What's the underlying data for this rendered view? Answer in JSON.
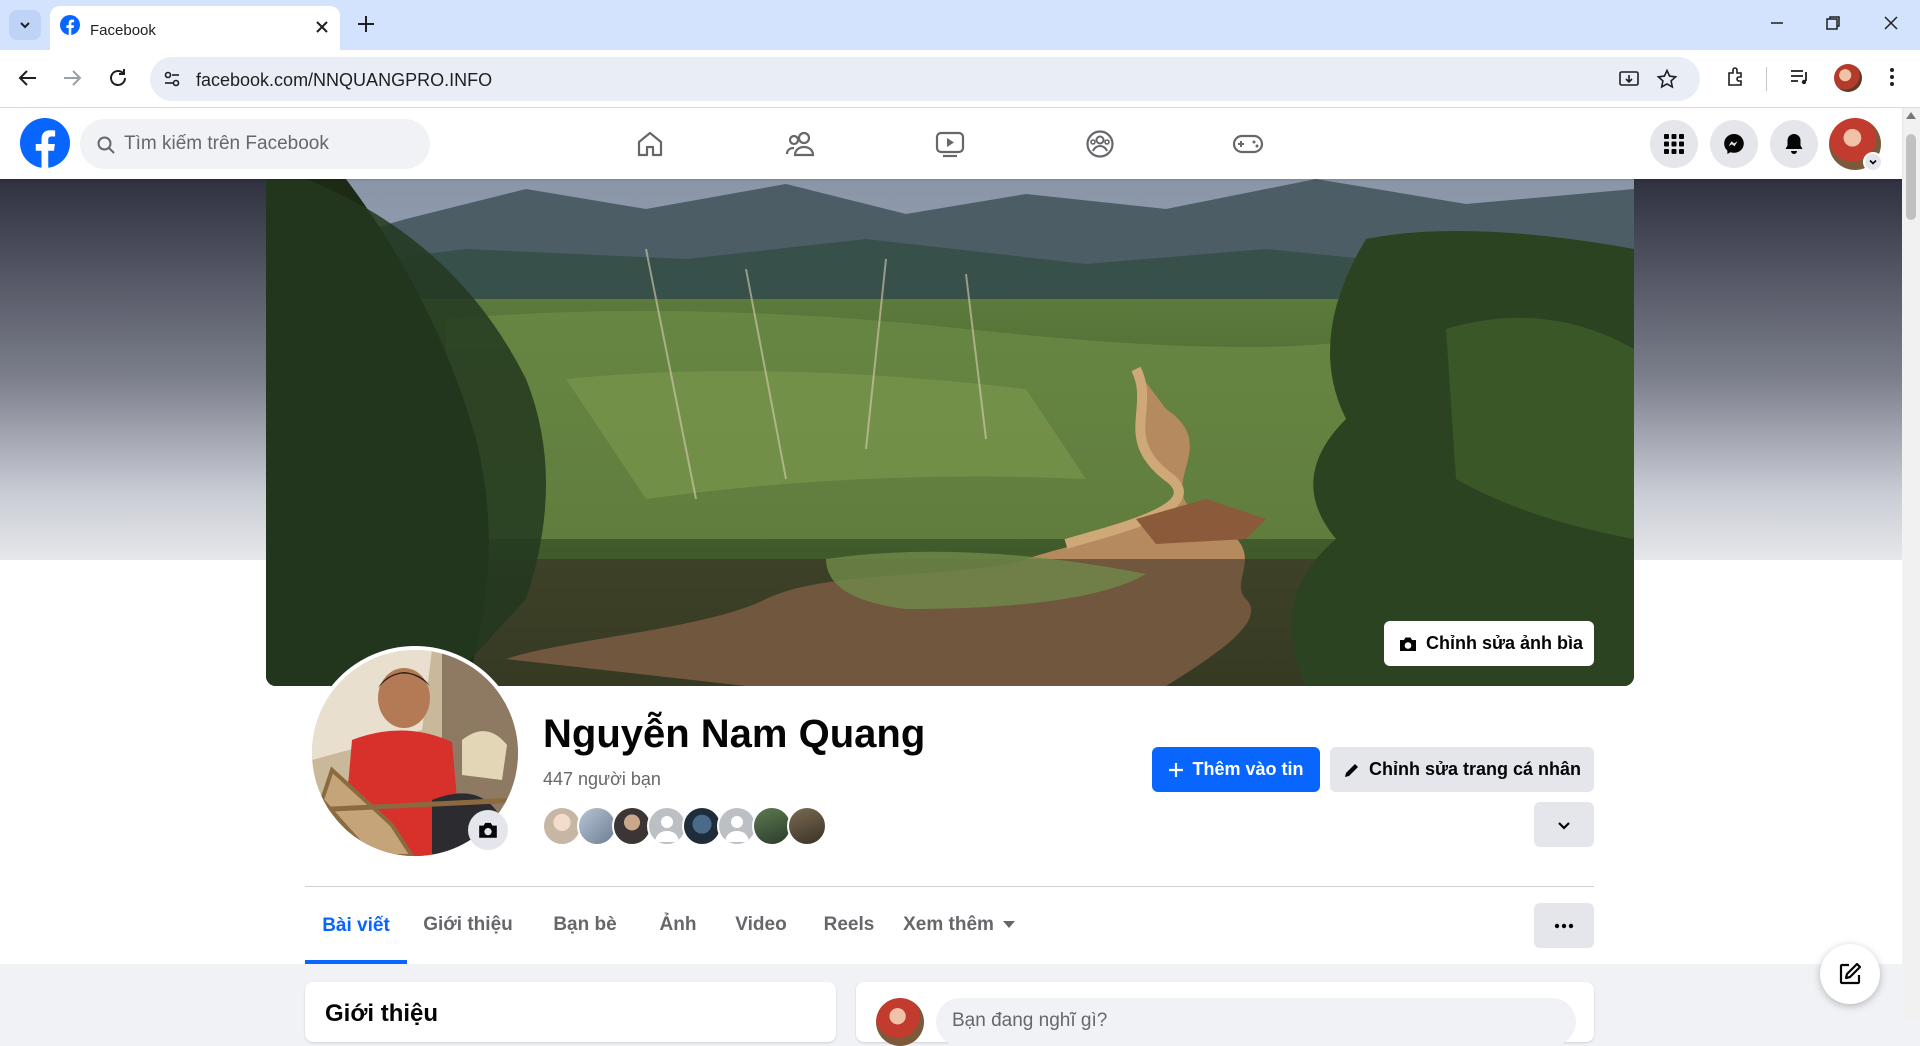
{
  "browser": {
    "tab_title": "Facebook",
    "url": "facebook.com/NNQUANGPRO.INFO"
  },
  "fb_header": {
    "search_placeholder": "Tìm kiếm trên Facebook"
  },
  "profile": {
    "name": "Nguyễn Nam Quang",
    "friend_count": "447 người bạn",
    "edit_cover_label": "Chỉnh sửa ảnh bìa",
    "add_story_label": "Thêm vào tin",
    "edit_profile_label": "Chỉnh sửa trang cá nhân"
  },
  "tabs": [
    {
      "label": "Bài viết"
    },
    {
      "label": "Giới thiệu"
    },
    {
      "label": "Bạn bè"
    },
    {
      "label": "Ảnh"
    },
    {
      "label": "Video"
    },
    {
      "label": "Reels"
    },
    {
      "label": "Xem thêm"
    }
  ],
  "intro": {
    "heading": "Giới thiệu"
  },
  "composer": {
    "placeholder": "Bạn đang nghĩ gì?"
  },
  "colors": {
    "fb_blue": "#0866ff",
    "chrome_tabstrip": "#d3e3fd"
  }
}
